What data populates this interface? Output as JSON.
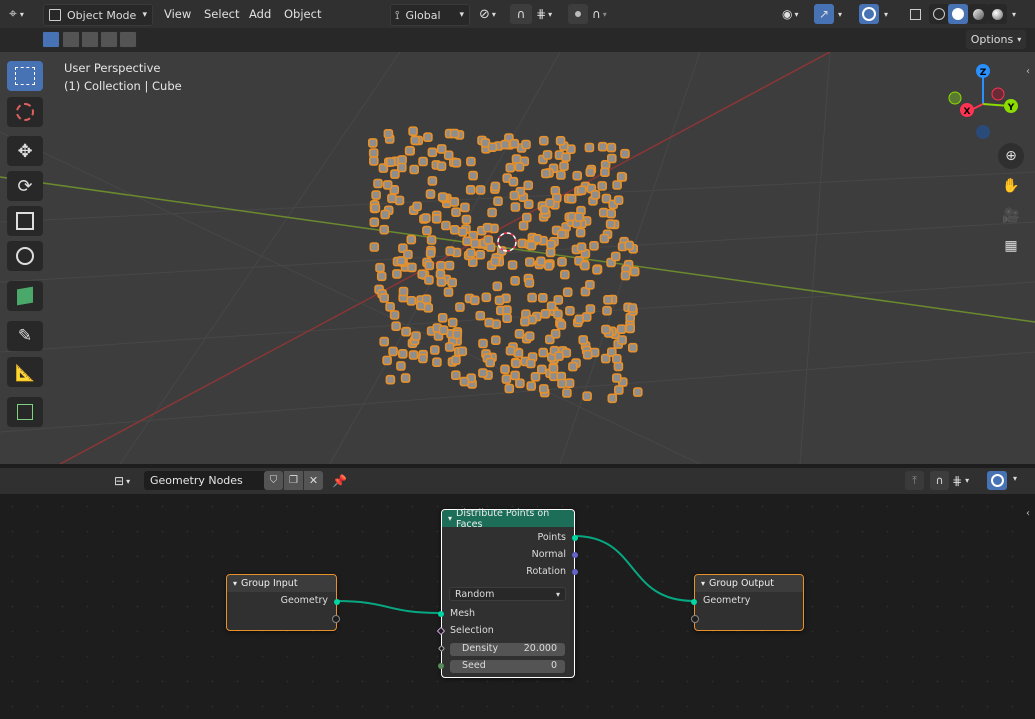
{
  "header": {
    "mode": "Object Mode",
    "menus": [
      "View",
      "Select",
      "Add",
      "Object"
    ],
    "transform_orientation": "Global",
    "options_label": "Options"
  },
  "viewport": {
    "view_name": "User Perspective",
    "collection_info": "(1) Collection | Cube",
    "gizmo": {
      "z": "Z",
      "y": "Y",
      "x": "X"
    }
  },
  "node_editor": {
    "tree_name": "Geometry Nodes",
    "nodes": {
      "group_input": {
        "title": "Group Input",
        "output": "Geometry"
      },
      "distribute": {
        "title": "Distribute Points on Faces",
        "outputs": [
          "Points",
          "Normal",
          "Rotation"
        ],
        "mode": "Random",
        "inputs": [
          "Mesh",
          "Selection"
        ],
        "density_label": "Density",
        "density_value": "20.000",
        "seed_label": "Seed",
        "seed_value": "0"
      },
      "group_output": {
        "title": "Group Output",
        "input": "Geometry"
      }
    }
  },
  "colors": {
    "selection_orange": "#e8912a",
    "x_axis": "#ff3352",
    "y_axis": "#8bdc00",
    "z_axis": "#2890ff",
    "node_header_distribute": "#1c6e58",
    "node_header_group": "#3c3c3c",
    "geometry_socket": "#00d6a3",
    "vector_socket": "#6363c7"
  }
}
